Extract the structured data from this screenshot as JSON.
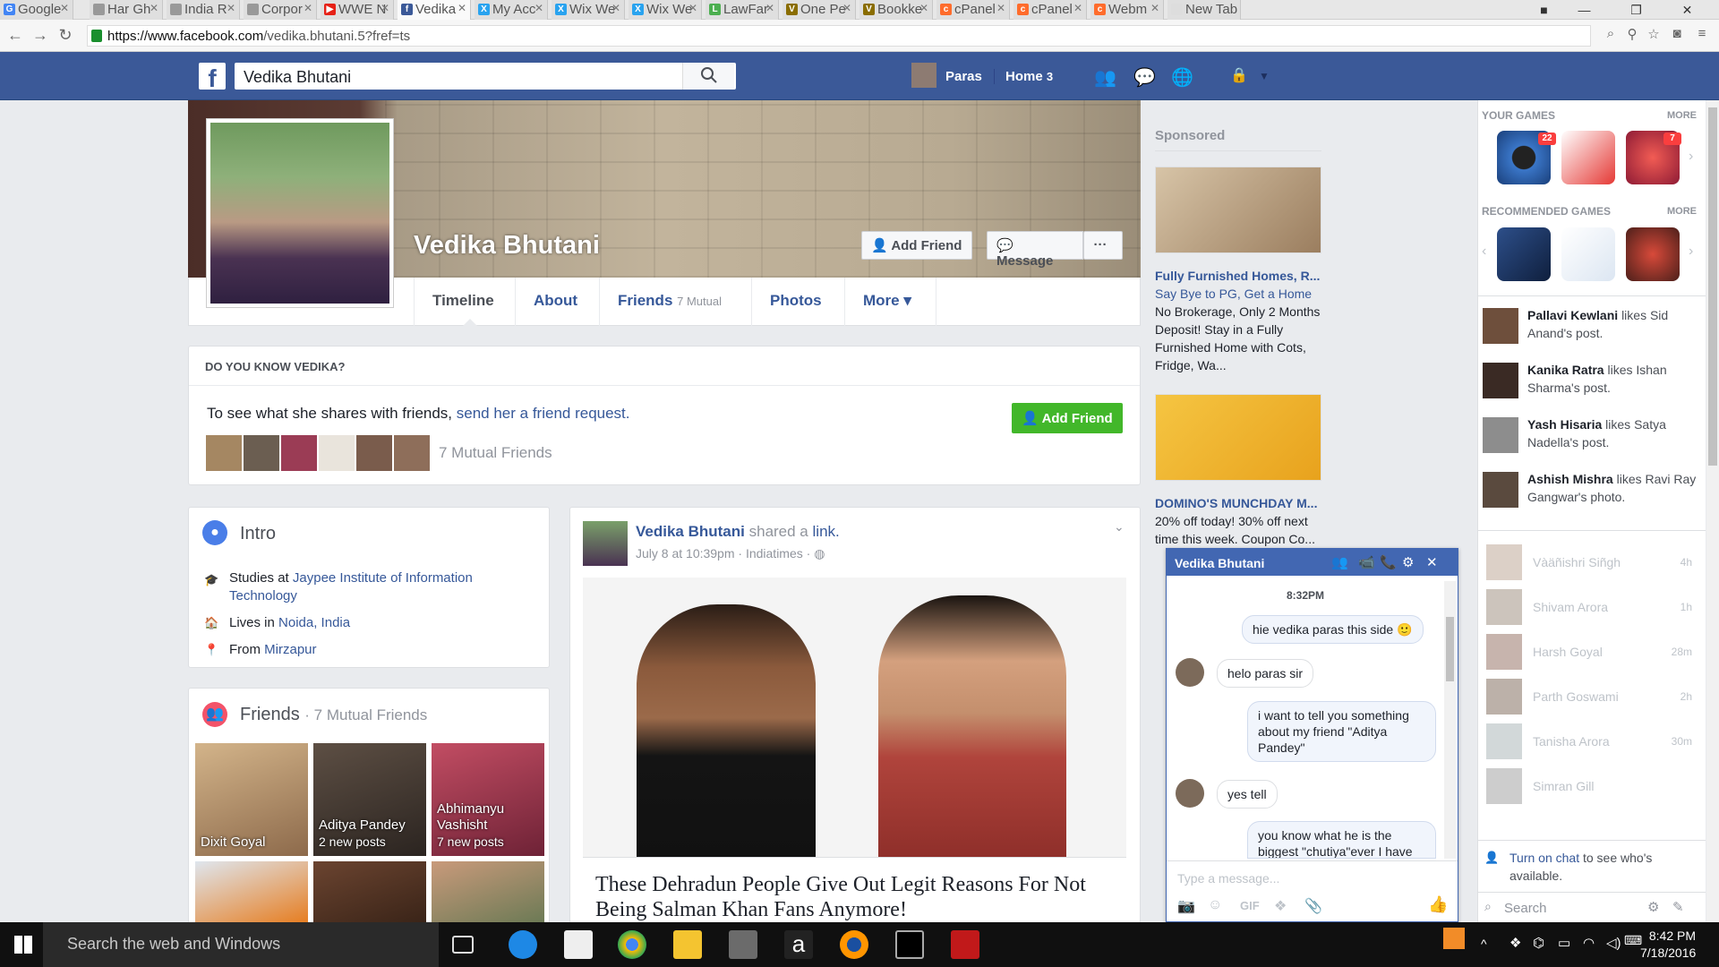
{
  "browser": {
    "tabs": [
      {
        "label": "Google",
        "icon_color": "#4285f4",
        "icon_letter": "G",
        "active": false
      },
      {
        "label": "Har Gh",
        "icon_color": "#999999",
        "icon_letter": "",
        "active": false
      },
      {
        "label": "India R",
        "icon_color": "#999999",
        "icon_letter": "",
        "active": false
      },
      {
        "label": "Corpor",
        "icon_color": "#999999",
        "icon_letter": "",
        "active": false
      },
      {
        "label": "WWE N",
        "icon_color": "#e62117",
        "icon_letter": "▶",
        "active": false
      },
      {
        "label": "Vedika",
        "icon_color": "#3b5998",
        "icon_letter": "f",
        "active": true
      },
      {
        "label": "My Acc",
        "icon_color": "#29a3ef",
        "icon_letter": "X",
        "active": false
      },
      {
        "label": "Wix We",
        "icon_color": "#29a3ef",
        "icon_letter": "X",
        "active": false
      },
      {
        "label": "Wix We",
        "icon_color": "#29a3ef",
        "icon_letter": "X",
        "active": false
      },
      {
        "label": "LawFar",
        "icon_color": "#4caf50",
        "icon_letter": "L",
        "active": false
      },
      {
        "label": "One Pe",
        "icon_color": "#8a6d00",
        "icon_letter": "V",
        "active": false
      },
      {
        "label": "Bookke",
        "icon_color": "#8a6d00",
        "icon_letter": "V",
        "active": false
      },
      {
        "label": "cPanel",
        "icon_color": "#ff6c2c",
        "icon_letter": "c",
        "active": false
      },
      {
        "label": "cPanel",
        "icon_color": "#ff6c2c",
        "icon_letter": "c",
        "active": false
      },
      {
        "label": "Webm",
        "icon_color": "#ff6c2c",
        "icon_letter": "c",
        "active": false
      },
      {
        "label": "New Tab",
        "icon_color": "#dddddd",
        "icon_letter": "",
        "active": false
      }
    ],
    "url_host": "https://www.facebook.com",
    "url_path": "/vedika.bhutani.5?fref=ts"
  },
  "fb": {
    "search_value": "Vedika Bhutani",
    "nav_user": "Paras",
    "nav_home": "Home",
    "nav_home_count": "3"
  },
  "profile": {
    "name": "Vedika Bhutani",
    "add_friend": "Add Friend",
    "message": "Message",
    "more_dots": "···",
    "tabs": {
      "timeline": "Timeline",
      "about": "About",
      "friends": "Friends",
      "friends_sub": "7 Mutual",
      "photos": "Photos",
      "more": "More ▾"
    }
  },
  "dyk": {
    "title": "DO YOU KNOW VEDIKA?",
    "text": "To see what she shares with friends,",
    "link": "send her a friend request.",
    "button": "Add Friend",
    "mutual": "7 Mutual Friends"
  },
  "intro": {
    "title": "Intro",
    "studies_prefix": "Studies at",
    "studies_link": "Jaypee Institute of Information Technology",
    "lives_prefix": "Lives in",
    "lives_link": "Noida, India",
    "from_prefix": "From",
    "from_link": "Mirzapur"
  },
  "friends": {
    "title": "Friends",
    "sub": "· 7 Mutual Friends",
    "tiles": [
      {
        "name": "Dixit Goyal",
        "posts": ""
      },
      {
        "name": "Aditya Pandey",
        "posts": "2 new posts"
      },
      {
        "name": "Abhimanyu Vashisht",
        "posts": "7 new posts"
      },
      {
        "name": "",
        "posts": ""
      },
      {
        "name": "",
        "posts": ""
      },
      {
        "name": "",
        "posts": ""
      }
    ]
  },
  "post": {
    "author": "Vedika Bhutani",
    "action_text": "shared a",
    "action_link": "link.",
    "meta": "July 8 at 10:39pm · Indiatimes · ",
    "title": "These Dehradun People Give Out Legit Reasons For Not Being Salman Khan Fans Anymore!"
  },
  "sponsored": {
    "label": "Sponsored",
    "ads": [
      {
        "title": "Fully Furnished Homes, R...",
        "url": "Say Bye to PG, Get a Home",
        "desc": "No Brokerage, Only 2 Months Deposit! Stay in a Fully Furnished Home with Cots, Fridge, Wa..."
      },
      {
        "title": "DOMINO'S MUNCHDAY M...",
        "url": "",
        "desc": "20% off today! 30% off next time this week. Coupon Co..."
      }
    ]
  },
  "sidebar": {
    "your_games": "YOUR GAMES",
    "recommended": "RECOMMENDED GAMES",
    "more": "MORE",
    "game_badges": [
      "22",
      "",
      "7"
    ],
    "ticker": [
      {
        "name": "Pallavi Kewlani",
        "rest": "likes Sid Anand's post."
      },
      {
        "name": "Kanika Ratra",
        "rest": "likes Ishan Sharma's post."
      },
      {
        "name": "Yash Hisaria",
        "rest": "likes Satya Nadella's post."
      },
      {
        "name": "Ashish Mishra",
        "rest": "likes Ravi Ray Gangwar's photo."
      }
    ],
    "chat_users": [
      {
        "name": "Vàäñishri Siñgh",
        "time": "4h"
      },
      {
        "name": "Shivam Arora",
        "time": "1h"
      },
      {
        "name": "Harsh Goyal",
        "time": "28m"
      },
      {
        "name": "Parth Goswami",
        "time": "2h"
      },
      {
        "name": "Tanisha Arora",
        "time": "30m"
      },
      {
        "name": "Simran Gill",
        "time": ""
      }
    ],
    "turn_on_link": "Turn on chat",
    "turn_on_rest": "to see who's available.",
    "search_placeholder": "Search"
  },
  "chat": {
    "title": "Vedika Bhutani",
    "time": "8:32PM",
    "messages": [
      {
        "from": "me",
        "text": "hie vedika paras this side 🙂"
      },
      {
        "from": "them",
        "text": "helo paras sir"
      },
      {
        "from": "me",
        "text": "i want to tell you something about my friend \"Aditya Pandey\""
      },
      {
        "from": "them",
        "text": "yes tell"
      },
      {
        "from": "me",
        "text": "you know what he is the biggest \"chutiya\"ever I have"
      }
    ],
    "input_placeholder": "Type a message...",
    "gif": "GIF"
  },
  "taskbar": {
    "search": "Search the web and Windows",
    "time": "8:42 PM",
    "date": "7/18/2016"
  }
}
